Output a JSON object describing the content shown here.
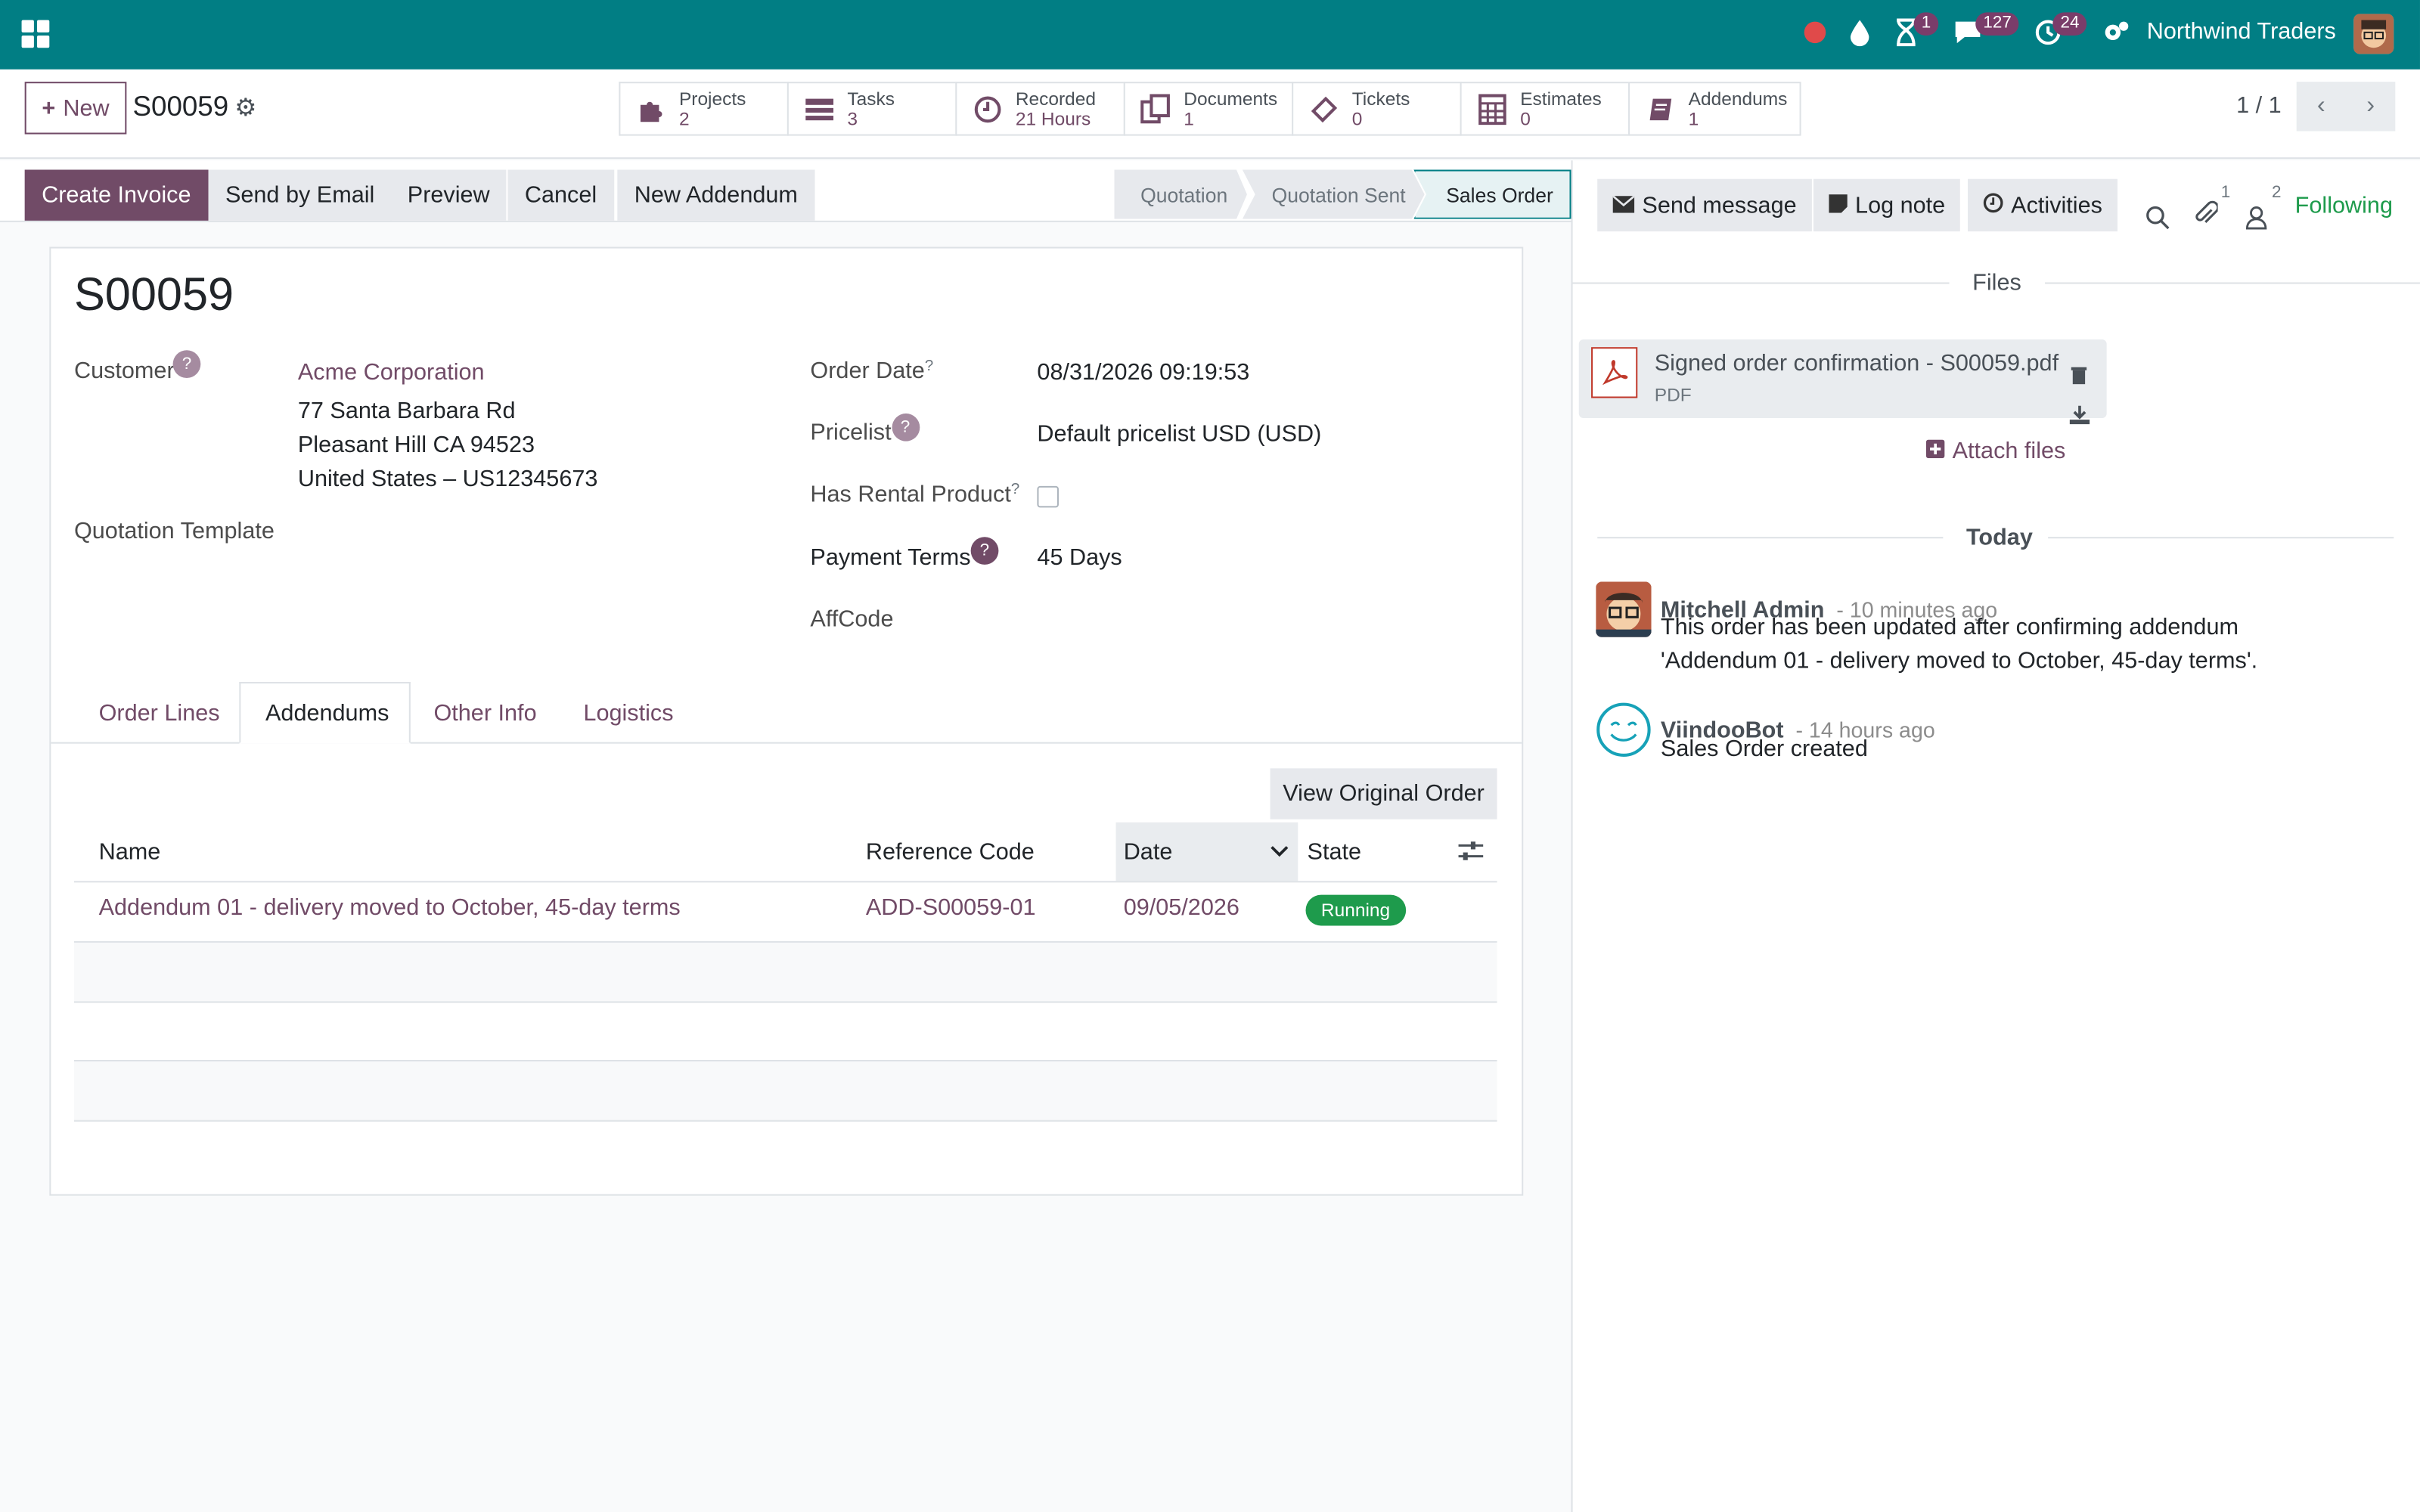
{
  "navbar": {
    "company": "Northwind Traders",
    "activity_count": "1",
    "messages_count": "127",
    "activities_count": "24"
  },
  "control": {
    "new_label": "New",
    "record_name": "S00059",
    "pager": "1 / 1"
  },
  "smart_buttons": [
    {
      "title": "Projects",
      "value": "2",
      "icon": "puzzle-icon"
    },
    {
      "title": "Tasks",
      "value": "3",
      "icon": "tasks-icon"
    },
    {
      "title": "Recorded",
      "value": "21 Hours",
      "icon": "clock-icon"
    },
    {
      "title": "Documents",
      "value": "1",
      "icon": "documents-icon"
    },
    {
      "title": "Tickets",
      "value": "0",
      "icon": "ticket-icon"
    },
    {
      "title": "Estimates",
      "value": "0",
      "icon": "calculator-icon"
    },
    {
      "title": "Addendums",
      "value": "1",
      "icon": "book-icon"
    }
  ],
  "actions": {
    "create_invoice": "Create Invoice",
    "send_email": "Send by Email",
    "preview": "Preview",
    "cancel": "Cancel",
    "new_addendum": "New Addendum"
  },
  "stages": [
    "Quotation",
    "Quotation Sent",
    "Sales Order"
  ],
  "form": {
    "title": "S00059",
    "customer_label": "Customer",
    "customer_name": "Acme Corporation",
    "address1": "77 Santa Barbara Rd",
    "address2": "Pleasant Hill CA 94523",
    "address3": "United States – US12345673",
    "quotation_template_label": "Quotation Template",
    "order_date_label": "Order Date",
    "order_date": "08/31/2026 09:19:53",
    "pricelist_label": "Pricelist",
    "pricelist": "Default pricelist USD (USD)",
    "rental_label": "Has Rental Product",
    "payment_terms_label": "Payment Terms",
    "payment_terms": "45 Days",
    "affcode_label": "AffCode"
  },
  "tabs": [
    "Order Lines",
    "Addendums",
    "Other Info",
    "Logistics"
  ],
  "addendums": {
    "view_original": "View Original Order",
    "columns": [
      "Name",
      "Reference Code",
      "Date",
      "State"
    ],
    "rows": [
      {
        "name": "Addendum 01 - delivery moved to October, 45-day terms",
        "ref": "ADD-S00059-01",
        "date": "09/05/2026",
        "state": "Running"
      }
    ]
  },
  "chatter": {
    "send_message": "Send message",
    "log_note": "Log note",
    "activities": "Activities",
    "attachments_count": "1",
    "followers_count": "2",
    "following": "Following",
    "files_header": "Files",
    "file_name": "Signed order confirmation - S00059.pdf",
    "file_type": "PDF",
    "attach_files": "Attach files",
    "today": "Today",
    "messages": [
      {
        "author": "Mitchell Admin",
        "time": "- 10 minutes ago",
        "line1": "This order has been updated after confirming addendum",
        "line2": "'Addendum 01 - delivery moved to October, 45-day terms'."
      },
      {
        "author": "ViindooBot",
        "time": "- 14 hours ago",
        "line1": "Sales Order created",
        "line2": ""
      }
    ]
  },
  "colors": {
    "navbar": "#017e84",
    "brand": "#714b67",
    "running": "#1e9b4c"
  }
}
